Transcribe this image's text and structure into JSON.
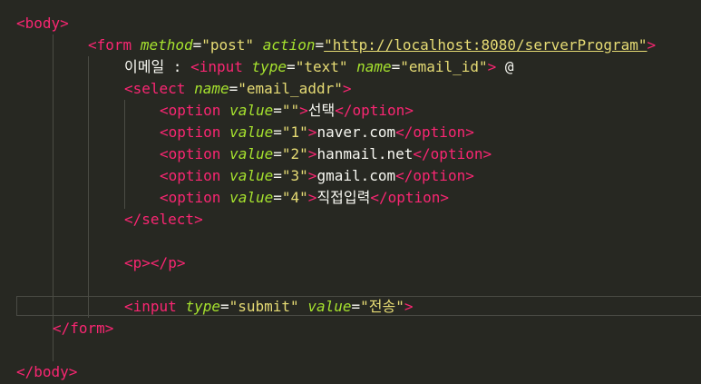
{
  "colors": {
    "background": "#272822",
    "tag": "#f92672",
    "attribute": "#a6e22e",
    "string": "#e6db74",
    "text": "#f8f8f2"
  },
  "code": {
    "body_open": "body",
    "form_tag": "form",
    "form_attr_method": "method",
    "form_method_val": "\"post\"",
    "form_attr_action": "action",
    "form_action_val": "\"http://localhost:8080/serverProgram\"",
    "email_label": "이메일 : ",
    "input1_tag": "input",
    "input1_attr_type": "type",
    "input1_type_val": "\"text\"",
    "input1_attr_name": "name",
    "input1_name_val": "\"email_id\"",
    "at_sign": " @",
    "select_tag": "select",
    "select_attr_name": "name",
    "select_name_val": "\"email_addr\"",
    "option_tag": "option",
    "option_attr_value": "value",
    "options": [
      {
        "value": "\"\"",
        "text": "선택"
      },
      {
        "value": "\"1\"",
        "text": "naver.com"
      },
      {
        "value": "\"2\"",
        "text": "hanmail.net"
      },
      {
        "value": "\"3\"",
        "text": "gmail.com"
      },
      {
        "value": "\"4\"",
        "text": "직접입력"
      }
    ],
    "p_tag": "p",
    "input2_tag": "input",
    "input2_attr_type": "type",
    "input2_type_val": "\"submit\"",
    "input2_attr_value": "value",
    "input2_value_val": "\"전송\"",
    "form_close": "form",
    "body_close": "body"
  }
}
